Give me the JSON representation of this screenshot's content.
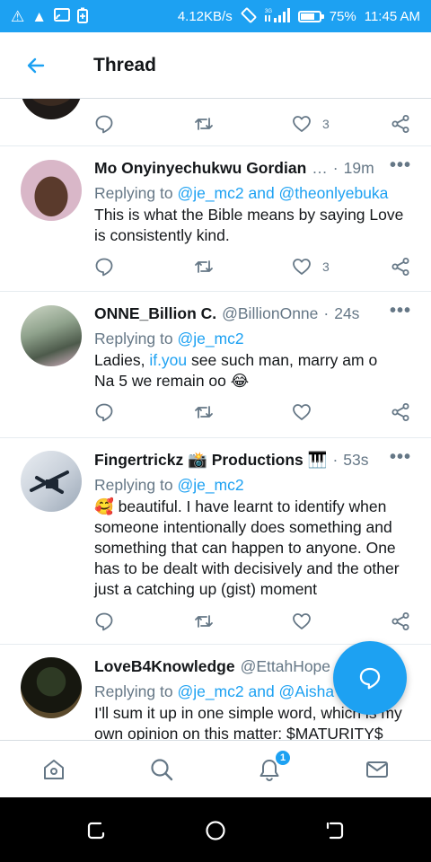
{
  "status_bar": {
    "net_speed": "4.12KB/s",
    "network_type": "3G",
    "battery_percent": "75%",
    "battery_level": 0.75,
    "time": "11:45 AM"
  },
  "header": {
    "title": "Thread"
  },
  "colors": {
    "accent": "#1da1f2",
    "text": "#14171a",
    "secondary": "#657786",
    "divider": "#e6ecf0"
  },
  "tweets": [
    {
      "counts": {
        "like": "3"
      }
    },
    {
      "author": "Mo Onyinyechukwu Gordian",
      "ellipsis": "…",
      "separator": "·",
      "time": "19m",
      "replying_prefix": "Replying to",
      "replying_to": "@je_mc2 and @theonlyebuka",
      "text": "This is what the Bible means by saying Love is consistently kind.",
      "counts": {
        "like": "3"
      }
    },
    {
      "author": "ONNE_Billion C.",
      "handle": "@BillionOnne",
      "separator": "·",
      "time": "24s",
      "replying_prefix": "Replying to",
      "replying_to": "@je_mc2",
      "text_before": "Ladies,",
      "text_link": "if.you",
      "text_after": "see such man, marry am o",
      "text_line2": "Na 5 we remain oo 😂"
    },
    {
      "author": "Fingertrickz 📸 Productions 🎹",
      "separator": "·",
      "time": "53s",
      "replying_prefix": "Replying to",
      "replying_to": "@je_mc2",
      "text": "🥰 beautiful. I have learnt to identify when someone intentionally does something and something that can happen to anyone. One has to be dealt with decisively and the other just a catching up (gist) moment"
    },
    {
      "author": "LoveB4Knowledge",
      "handle": "@EttahHope",
      "replying_prefix": "Replying to",
      "replying_to": "@je_mc2 and @Aisha",
      "text": "I'll sum it up in one simple word, which is my own opinion on this matter: $MATURITY$"
    }
  ],
  "icons": {
    "back": "arrow-left-icon",
    "reply": "comment-icon",
    "retweet": "retweet-icon",
    "like": "heart-icon",
    "share": "share-icon",
    "compose": "reply-compose-icon",
    "tabs": [
      "home-icon",
      "search-icon",
      "notifications-icon",
      "messages-icon"
    ]
  },
  "tabbar": {
    "notifications_badge": "1"
  }
}
